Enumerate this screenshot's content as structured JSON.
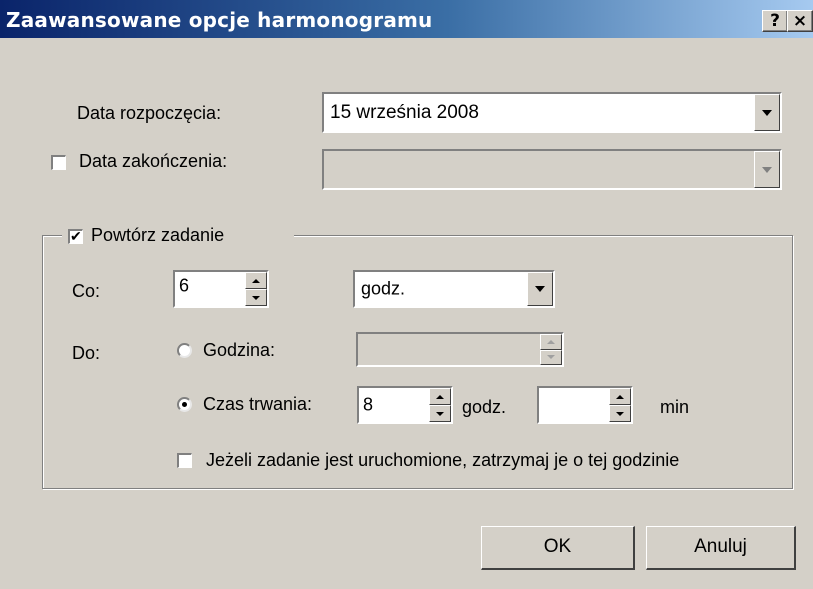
{
  "window": {
    "title": "Zaawansowane opcje harmonogramu",
    "help_label": "?",
    "close_label": "×"
  },
  "start_date": {
    "label": "Data rozpoczęcia:",
    "value": "15   września   2008"
  },
  "end_date": {
    "label": "Data zakończenia:",
    "checked": false,
    "value": ""
  },
  "repeat": {
    "label": "Powtórz zadanie",
    "checked": true,
    "every_label": "Co:",
    "every_value": "6",
    "unit_value": "godz.",
    "until_label": "Do:",
    "time_radio_label": "Godzina:",
    "time_value": "",
    "duration_radio_label": "Czas trwania:",
    "duration_hours": "8",
    "hours_unit": "godz.",
    "duration_minutes": "",
    "minutes_unit": "min",
    "stop_label": "Jeżeli zadanie jest uruchomione, zatrzymaj je o tej godzinie",
    "stop_checked": false
  },
  "buttons": {
    "ok": "OK",
    "cancel": "Anuluj"
  }
}
